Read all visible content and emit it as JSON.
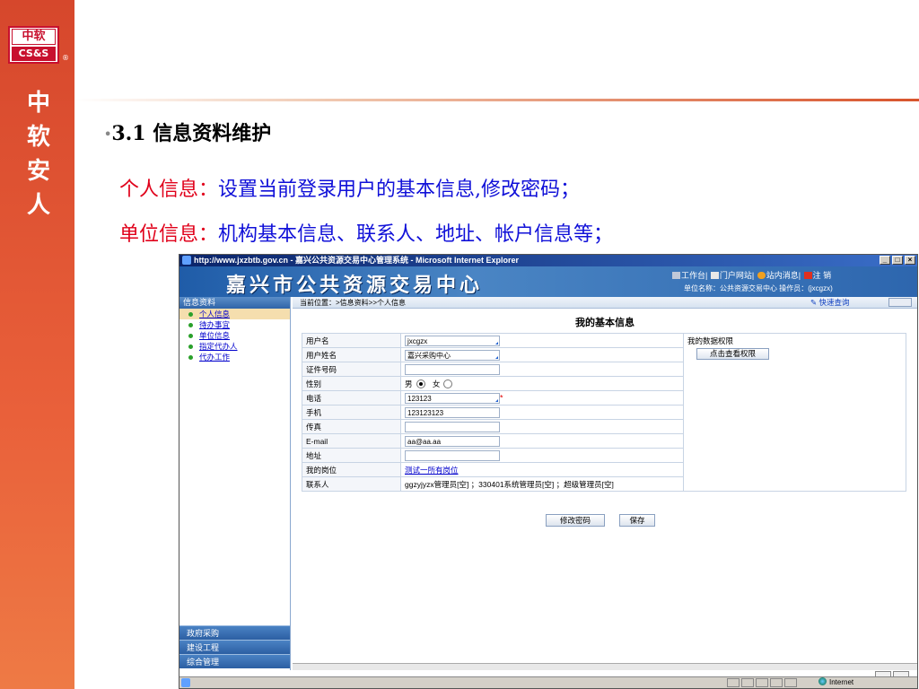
{
  "logo": {
    "line1": "中软",
    "line2": "CS&S",
    "reg": "®"
  },
  "vertical_title": [
    "中",
    "软",
    "安",
    "人"
  ],
  "section": {
    "bullet": "•",
    "title": "3.1 信息资料维护"
  },
  "bullets": [
    {
      "key": "个人信息：",
      "text": "设置当前登录用户的基本信息,修改密码；"
    },
    {
      "key": "单位信息：",
      "text": "机构基本信息、联系人、地址、帐户信息等；"
    }
  ],
  "browser": {
    "window_title": "http://www.jxzbtb.gov.cn - 嘉兴公共资源交易中心管理系统 - Microsoft Internet Explorer",
    "win_buttons": [
      "_",
      "□",
      "×"
    ],
    "system_name": "嘉兴市公共资源交易中心",
    "top_links": [
      "工作台",
      "门户网站",
      "站内消息",
      "注 销"
    ],
    "unit_line": "单位名称：公共资源交易中心  操作员：(jxcgzx)",
    "sidebar": {
      "header": "信息资料",
      "items": [
        "个人信息",
        "待办事宜",
        "单位信息",
        "指定代办人",
        "代办工作"
      ],
      "categories": [
        "政府采购",
        "建设工程",
        "综合管理"
      ]
    },
    "breadcrumb": "当前位置：>信息资料>>个人信息",
    "quick_search": "快速查询",
    "form": {
      "title": "我的基本信息",
      "labels": {
        "username": "用户名",
        "fullname": "用户姓名",
        "idcard": "证件号码",
        "gender": "性别",
        "phone": "电话",
        "mobile": "手机",
        "fax": "传真",
        "email": "E-mail",
        "address": "地址",
        "post": "我的岗位",
        "contact": "联系人"
      },
      "values": {
        "username": "jxcgzx",
        "fullname": "嘉兴采购中心",
        "idcard": "",
        "gender_male": "男",
        "gender_female": "女",
        "phone": "123123",
        "mobile": "123123123",
        "fax": "",
        "email": "aa@aa.aa",
        "address": "",
        "post_link": "测试一所有岗位",
        "contact": "ggzyjyzx管理员[空] ；330401系统管理员[空] ；超级管理员[空]"
      },
      "required_mark": "*",
      "permissions_label": "我的数据权限",
      "permissions_button": "点击查看权限",
      "change_password": "修改密码",
      "save": "保存"
    },
    "status_zone": "Internet"
  }
}
